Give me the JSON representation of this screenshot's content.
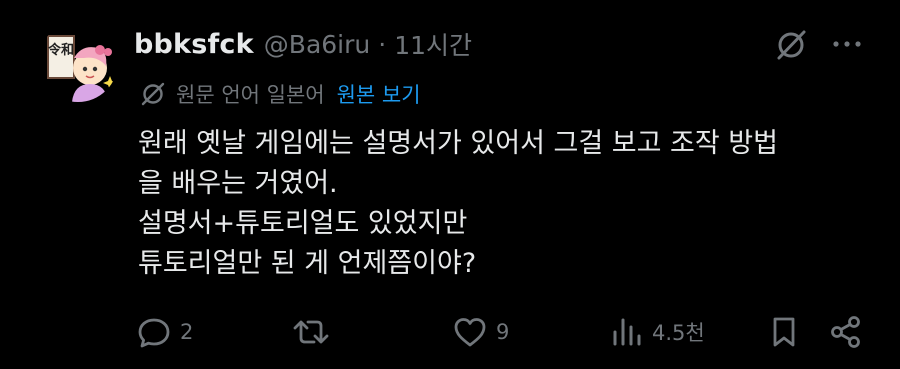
{
  "tweet": {
    "author": {
      "display_name": "bbksfck",
      "handle": "@Ba6iru",
      "avatar_icon": "anime-mascot-avatar",
      "avatar_text": "令和"
    },
    "separator": "·",
    "time": "11시간",
    "translation": {
      "label": "원문 언어 일본어",
      "link": "원본 보기"
    },
    "body_lines": [
      "원래 옛날 게임에는 설명서가 있어서 그걸 보고 조작 방법",
      "을 배우는 거였어.",
      "설명서+튜토리얼도 있었지만",
      "튜토리얼만 된 게 언제쯤이야?"
    ],
    "actions": {
      "reply_count": "2",
      "repost_count": "",
      "like_count": "9",
      "views_count": "4.5천"
    }
  },
  "colors": {
    "background": "#000000",
    "text": "#e7e9ea",
    "muted": "#71767b",
    "accent": "#1d9bf0"
  }
}
